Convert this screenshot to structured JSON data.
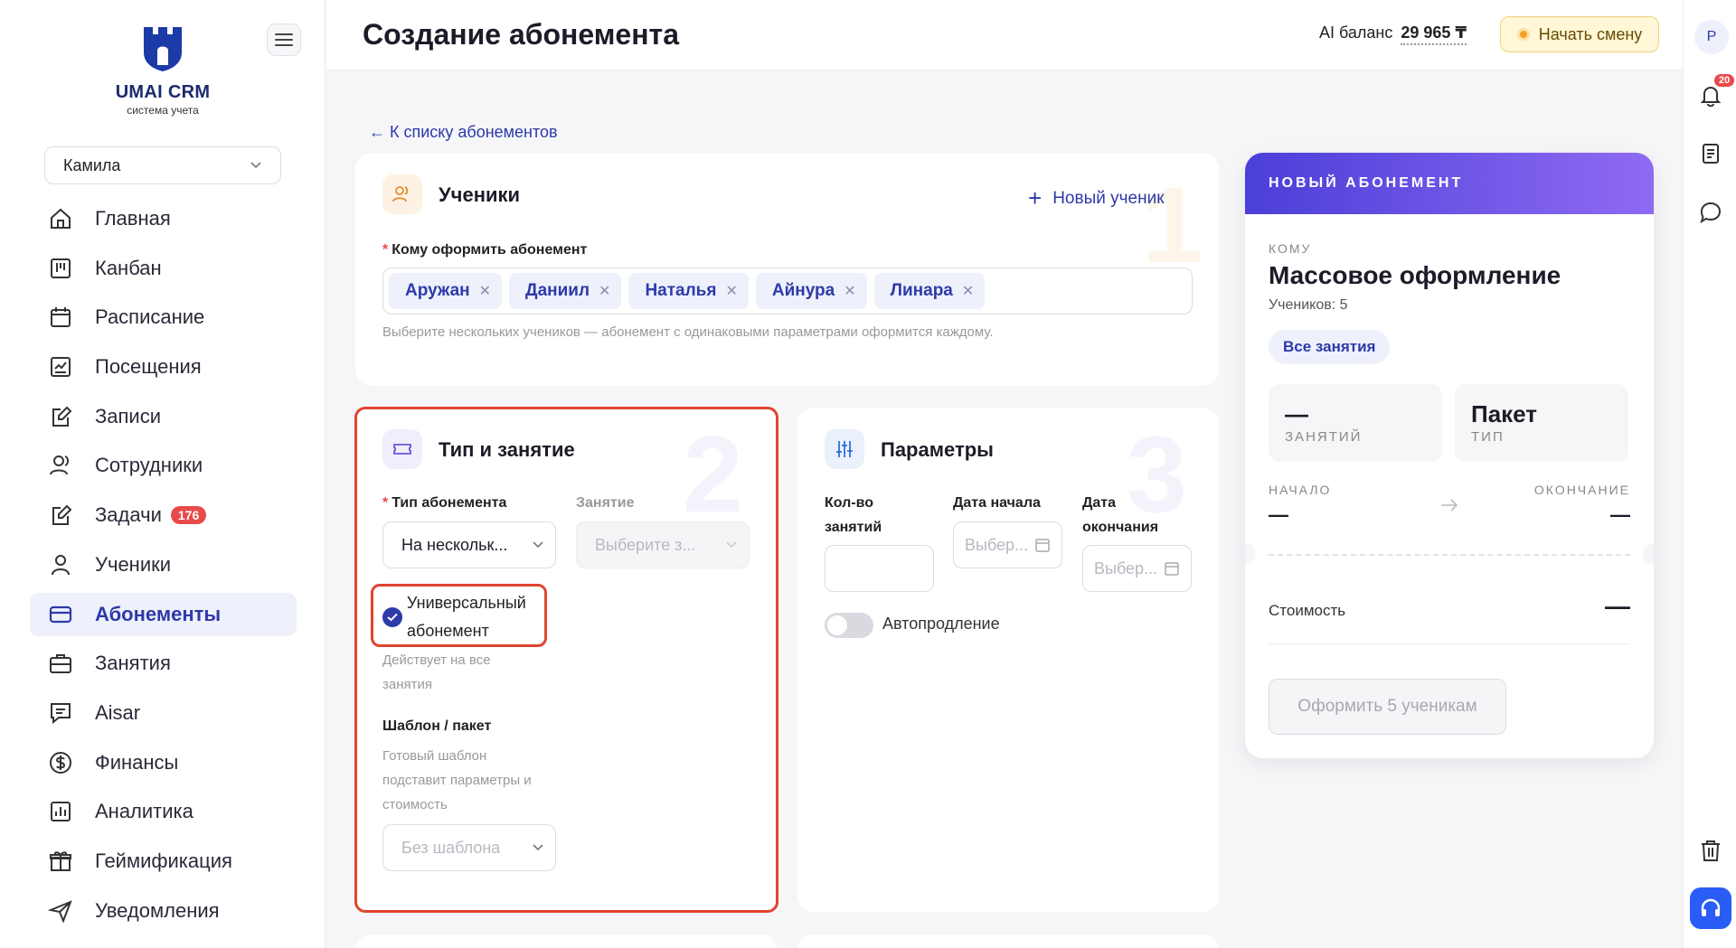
{
  "logo": {
    "name": "UMAI CRM",
    "subtitle": "система учета"
  },
  "user_select": {
    "value": "Камила"
  },
  "nav": [
    {
      "label": "Главная",
      "icon": "home-icon"
    },
    {
      "label": "Канбан",
      "icon": "kanban-icon"
    },
    {
      "label": "Расписание",
      "icon": "calendar-icon"
    },
    {
      "label": "Посещения",
      "icon": "attendance-icon"
    },
    {
      "label": "Записи",
      "icon": "edit-icon"
    },
    {
      "label": "Сотрудники",
      "icon": "staff-icon"
    },
    {
      "label": "Задачи",
      "icon": "tasks-icon",
      "badge": "176"
    },
    {
      "label": "Ученики",
      "icon": "student-icon"
    },
    {
      "label": "Абонементы",
      "icon": "card-icon",
      "active": true
    },
    {
      "label": "Занятия",
      "icon": "briefcase-icon"
    },
    {
      "label": "Aisar",
      "icon": "chat-icon"
    },
    {
      "label": "Финансы",
      "icon": "dollar-icon"
    },
    {
      "label": "Аналитика",
      "icon": "analytics-icon"
    },
    {
      "label": "Геймификация",
      "icon": "gift-icon"
    },
    {
      "label": "Уведомления",
      "icon": "send-icon"
    }
  ],
  "header": {
    "title": "Создание абонемента",
    "ai_balance_label": "AI баланс",
    "ai_balance_value": "29 965 ₸",
    "start_shift": "Начать смену"
  },
  "rail": {
    "avatar": "Р",
    "notifications_count": "20"
  },
  "back_link": "← К списку абонементов",
  "students_card": {
    "number": "1",
    "title": "Ученики",
    "new_student": "Новый ученик",
    "field_label": "Кому оформить абонемент",
    "chips": [
      "Аружан",
      "Даниил",
      "Наталья",
      "Айнура",
      "Линара"
    ],
    "hint": "Выберите нескольких учеников — абонемент с одинаковыми параметрами оформится каждому."
  },
  "type_card": {
    "number": "2",
    "title": "Тип и занятие",
    "type_label": "Тип абонемента",
    "type_value": "На нескольк...",
    "lesson_label": "Занятие",
    "lesson_placeholder": "Выберите з...",
    "universal_line1": "Универсальный",
    "universal_line2": "абонемент",
    "universal_hint_line1": "Действует на все",
    "universal_hint_line2": "занятия",
    "template_label": "Шаблон / пакет",
    "template_hint_line1": "Готовый шаблон",
    "template_hint_line2": "подставит параметры и",
    "template_hint_line3": "стоимость",
    "template_placeholder": "Без шаблона"
  },
  "params_card": {
    "number": "3",
    "title": "Параметры",
    "count_label_line1": "Кол-во",
    "count_label_line2": "занятий",
    "start_label": "Дата начала",
    "end_label_line1": "Дата",
    "end_label_line2": "окончания",
    "start_placeholder": "Выбер...",
    "end_placeholder": "Выбер...",
    "autorenew": "Автопродление"
  },
  "summary": {
    "header": "НОВЫЙ АБОНЕМЕНТ",
    "to_label": "КОМУ",
    "to_value": "Массовое оформление",
    "students_count": "Учеников: 5",
    "pill": "Все занятия",
    "lessons_value": "—",
    "lessons_label": "ЗАНЯТИЙ",
    "type_value": "Пакет",
    "type_label": "ТИП",
    "start_label": "НАЧАЛО",
    "end_label": "ОКОНЧАНИЕ",
    "start_value": "—",
    "end_value": "—",
    "cost_label": "Стоимость",
    "cost_value": "—",
    "submit": "Оформить 5 ученикам"
  },
  "colors": {
    "accent": "#2d3aa8",
    "highlight": "#e0452f",
    "badge": "#e84a4a"
  }
}
